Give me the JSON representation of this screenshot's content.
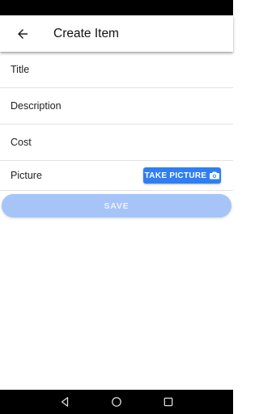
{
  "app_bar": {
    "title": "Create Item",
    "back_icon": "arrow-back-icon"
  },
  "form": {
    "fields": [
      {
        "label": "Title"
      },
      {
        "label": "Description"
      },
      {
        "label": "Cost"
      }
    ],
    "picture": {
      "label": "Picture",
      "button_label": "TAKE PICTURE",
      "button_icon": "camera-icon",
      "button_color": "#2f7ef5"
    },
    "save": {
      "label": "SAVE",
      "color": "#a6c4f8",
      "disabled": true
    }
  },
  "system_nav": {
    "back_icon": "nav-back-icon",
    "home_icon": "nav-home-icon",
    "recents_icon": "nav-recents-icon"
  }
}
